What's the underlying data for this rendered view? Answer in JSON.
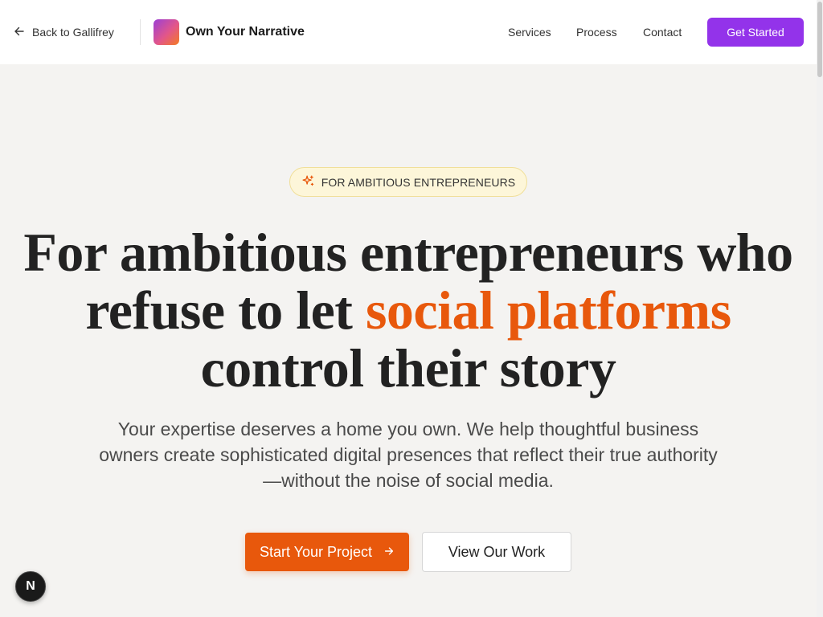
{
  "header": {
    "back_label": "Back to Gallifrey",
    "brand_name": "Own Your Narrative",
    "nav": [
      "Services",
      "Process",
      "Contact"
    ],
    "cta_label": "Get Started"
  },
  "hero": {
    "badge": "FOR AMBITIOUS ENTREPRENEURS",
    "headline_part1": "For ambitious entrepreneurs who refuse to let ",
    "headline_accent": "social platforms",
    "headline_part2": " control their story",
    "subtext": "Your expertise deserves a home you own. We help thoughtful business owners create sophisticated digital presences that reflect their true authority—without the noise of social media.",
    "primary_button": "Start Your Project",
    "secondary_button": "View Our Work"
  },
  "dev_indicator": "N",
  "icons": {
    "back": "arrow-left-icon",
    "badge": "sparkles-icon",
    "primary_button": "arrow-right-icon"
  },
  "colors": {
    "accent_orange": "#e8580c",
    "cta_purple": "#9333ea",
    "background": "#f4f3f1"
  }
}
